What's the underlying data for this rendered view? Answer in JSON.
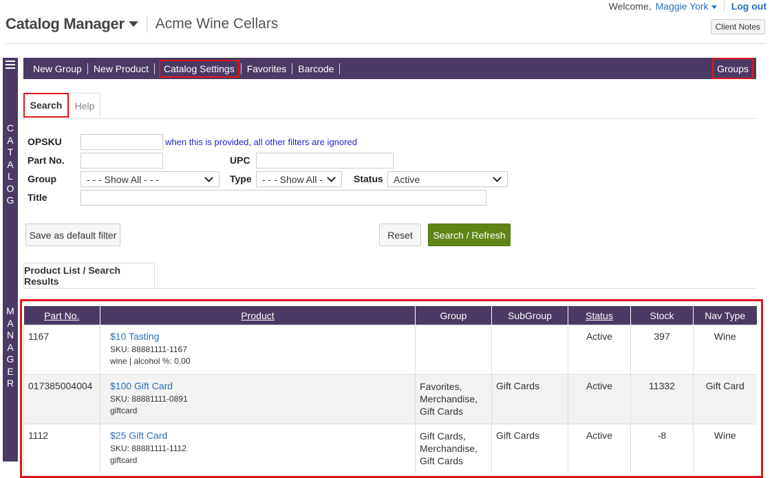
{
  "topbar": {
    "welcome": "Welcome,",
    "user": "Maggie York",
    "logout": "Log out"
  },
  "header": {
    "app_name": "Catalog Manager",
    "client_name": "Acme Wine Cellars",
    "client_notes": "Client Notes"
  },
  "rail": {
    "word1": [
      "C",
      "A",
      "T",
      "A",
      "L",
      "O",
      "G"
    ],
    "word2": [
      "M",
      "A",
      "N",
      "A",
      "G",
      "E",
      "R"
    ]
  },
  "nav": {
    "items": [
      "New Group",
      "New Product",
      "Catalog Settings",
      "Favorites",
      "Barcode"
    ],
    "groups": "Groups"
  },
  "tabs": {
    "search": "Search",
    "help": "Help"
  },
  "filters": {
    "opsku_label": "OPSKU",
    "opsku_value": "",
    "opsku_hint": "when this is provided, all other filters are ignored",
    "partno_label": "Part No.",
    "partno_value": "",
    "upc_label": "UPC",
    "upc_value": "",
    "group_label": "Group",
    "group_value": "- - - Show All - - -",
    "type_label": "Type",
    "type_value": "- - - Show All - - -",
    "status_label": "Status",
    "status_value": "Active",
    "title_label": "Title",
    "title_value": ""
  },
  "buttons": {
    "save_default": "Save as default filter",
    "reset": "Reset",
    "search_refresh": "Search / Refresh"
  },
  "results": {
    "tab_label": "Product List / Search Results",
    "columns": [
      "Part No.",
      "Product",
      "Group",
      "SubGroup",
      "Status",
      "Stock",
      "Nav Type"
    ],
    "rows": [
      {
        "part_no": "1167",
        "title": "$10 Tasting",
        "sku": "SKU: 88881111-1167",
        "meta": "wine | alcohol %: 0.00",
        "group": [],
        "subgroup": "",
        "status": "Active",
        "stock": "397",
        "nav_type": "Wine"
      },
      {
        "part_no": "017385004004",
        "title": "$100 Gift Card",
        "sku": "SKU: 88881111-0891",
        "meta": "giftcard",
        "group": [
          "Favorites,",
          "Merchandise,",
          "Gift Cards"
        ],
        "subgroup": "Gift Cards",
        "status": "Active",
        "stock": "11332",
        "nav_type": "Gift Card"
      },
      {
        "part_no": "1112",
        "title": "$25 Gift Card",
        "sku": "SKU: 88881111-1112",
        "meta": "giftcard",
        "group": [
          "Gift Cards,",
          "Merchandise,",
          "Gift Cards"
        ],
        "subgroup": "Gift Cards",
        "status": "Active",
        "stock": "-8",
        "nav_type": "Wine"
      }
    ]
  }
}
